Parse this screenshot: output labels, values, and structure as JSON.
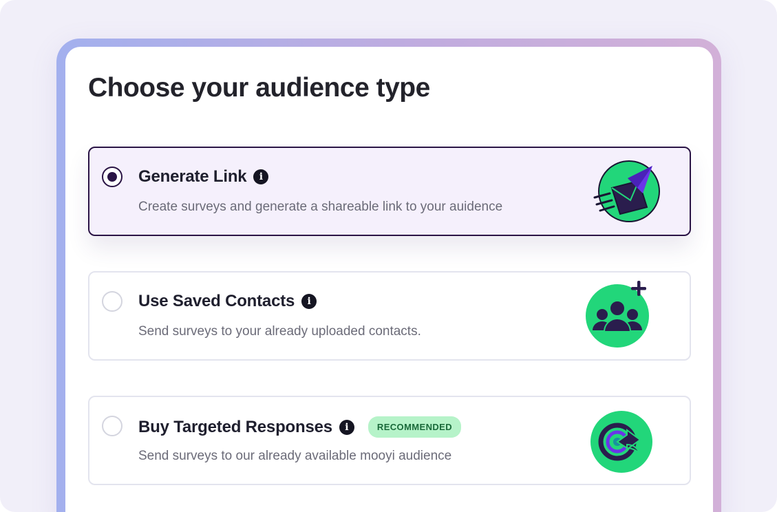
{
  "page": {
    "title": "Choose your audience type"
  },
  "options": [
    {
      "label": "Generate Link",
      "description": "Create surveys and generate a shareable link to your auidence",
      "selected": true,
      "icon": "paper-plane-envelope-icon"
    },
    {
      "label": "Use Saved Contacts",
      "description": "Send surveys to your already uploaded contacts.",
      "selected": false,
      "icon": "group-add-icon"
    },
    {
      "label": "Buy Targeted Responses",
      "description": "Send surveys to our already available mooyi audience",
      "selected": false,
      "badge": "RECOMMENDED",
      "icon": "target-arrow-icon"
    }
  ],
  "info_glyph": "i",
  "colors": {
    "accent_dark": "#2a1445",
    "accent_green": "#22d67a",
    "icon_purple": "#5b2bd6",
    "selected_bg": "#f5f0fc",
    "badge_bg": "#b6f3c9",
    "badge_text": "#1a6a3a"
  }
}
